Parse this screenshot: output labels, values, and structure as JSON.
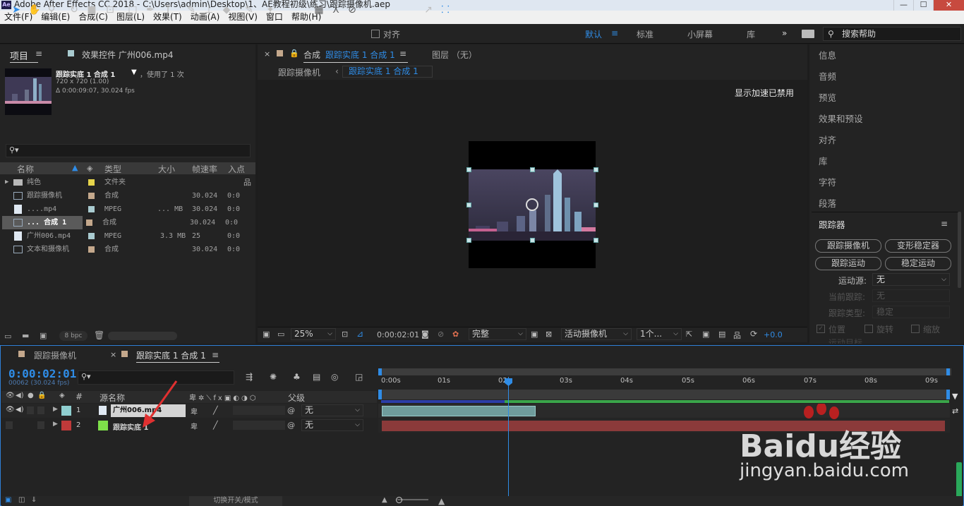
{
  "window": {
    "title": "Adobe After Effects CC 2018 - C:\\Users\\admin\\Desktop\\1、AE教程初级\\练习\\跟踪摄像机.aep",
    "icon": "Ae",
    "minimize": "—",
    "maximize": "☐",
    "close": "✕"
  },
  "menu": [
    "文件(F)",
    "编辑(E)",
    "合成(C)",
    "图层(L)",
    "效果(T)",
    "动画(A)",
    "视图(V)",
    "窗口",
    "帮助(H)"
  ],
  "toolbar": {
    "align_label": "对齐",
    "workspaces": [
      "默认",
      "标准",
      "小屏幕",
      "库"
    ],
    "active_workspace": "默认",
    "more": "»",
    "search_placeholder": "搜索帮助"
  },
  "project": {
    "tab_project": "项目",
    "tab_effects": "效果控件 广州006.mp4",
    "selected_name": "跟踪实底 1 合成 1",
    "used_text": "，使用了 1 次",
    "dims": "720 x 720 (1.00)",
    "duration": "Δ 0:00:09:07, 30.024 fps",
    "columns": {
      "name": "名称",
      "type": "类型",
      "size": "大小",
      "fps": "帧速率",
      "in": "入点"
    },
    "items": [
      {
        "name": "纯色",
        "type": "文件夹",
        "size": "",
        "fps": "",
        "in": ""
      },
      {
        "name": "跟踪摄像机",
        "type": "合成",
        "size": "",
        "fps": "30.024",
        "in": "0:0"
      },
      {
        "name": "....mp4",
        "type": "MPEG",
        "size": "... MB",
        "fps": "30.024",
        "in": "0:0"
      },
      {
        "name": "... 合成 1",
        "type": "合成",
        "size": "",
        "fps": "30.024",
        "in": "0:0"
      },
      {
        "name": "广州006.mp4",
        "type": "MPEG",
        "size": "3.3 MB",
        "fps": "25",
        "in": "0:0"
      },
      {
        "name": "文本和摄像机",
        "type": "合成",
        "size": "",
        "fps": "30.024",
        "in": "0:0"
      }
    ],
    "bpc": "8 bpc"
  },
  "composition": {
    "tab_label": "合成",
    "tab_name": "跟踪实底 1 合成 1",
    "layer_tab": "图层 （无）",
    "crumb_1": "跟踪摄像机",
    "crumb_2": "跟踪实底 1 合成 1",
    "accel_notice": "显示加速已禁用",
    "zoom": "25%",
    "timecode": "0:00:02:01",
    "quality": "完整",
    "camera": "活动摄像机",
    "views": "1个...",
    "exposure": "+0.0"
  },
  "right_panel": {
    "items": [
      "信息",
      "音频",
      "预览",
      "效果和预设",
      "对齐",
      "库",
      "字符",
      "段落"
    ],
    "tracker": {
      "title": "跟踪器",
      "btn_track_camera": "跟踪摄像机",
      "btn_warp_stabilizer": "变形稳定器",
      "btn_track_motion": "跟踪运动",
      "btn_stabilize_motion": "稳定运动",
      "motion_source_label": "运动源:",
      "motion_source_value": "无",
      "current_track_label": "当前跟踪:",
      "current_track_value": "无",
      "track_type_label": "跟踪类型:",
      "track_type_value": "稳定",
      "opt_position": "位置",
      "opt_rotation": "旋转",
      "opt_scale": "缩放",
      "motion_target": "运动目标"
    }
  },
  "timeline": {
    "tab_1": "跟踪摄像机",
    "tab_2": "跟踪实底 1 合成 1",
    "timecode": "0:00:02:01",
    "frame_info": "00062 (30.024 fps)",
    "col_hash": "#",
    "col_source": "源名称",
    "col_parent": "父级",
    "ruler": [
      "0:00s",
      "01s",
      "02s",
      "03s",
      "04s",
      "05s",
      "06s",
      "07s",
      "08s",
      "09s"
    ],
    "layers": [
      {
        "num": "1",
        "name": "广州006.mp4",
        "parent": "无",
        "label_color": "#8fcfd0"
      },
      {
        "num": "2",
        "name": "跟踪实底 1",
        "parent": "无",
        "label_color": "#c03a3a"
      }
    ],
    "toggle_label": "切换开关/模式"
  },
  "watermark": {
    "brand": "Baidu经验",
    "url": "jingyan.baidu.com"
  },
  "colors": {
    "accent": "#2f8ce6",
    "selection": "#4b4b4b",
    "solid_bar": "#8b3a3a",
    "video_bar": "#6f9c9c"
  }
}
